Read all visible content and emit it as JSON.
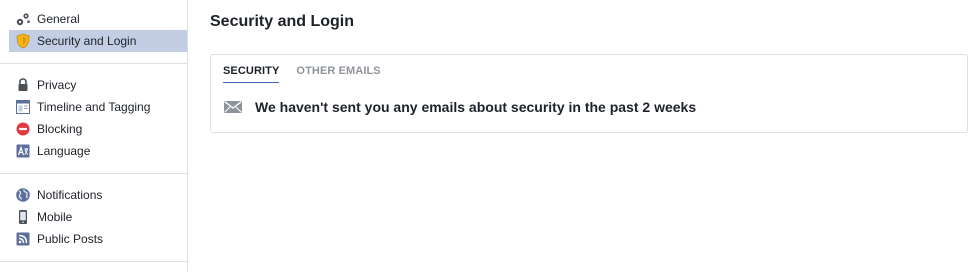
{
  "sidebar": {
    "groups": [
      {
        "items": [
          {
            "label": "General",
            "icon": "gears-icon"
          },
          {
            "label": "Security and Login",
            "icon": "shield-icon",
            "selected": true
          }
        ]
      },
      {
        "items": [
          {
            "label": "Privacy",
            "icon": "lock-icon"
          },
          {
            "label": "Timeline and Tagging",
            "icon": "timeline-icon"
          },
          {
            "label": "Blocking",
            "icon": "blocking-icon"
          },
          {
            "label": "Language",
            "icon": "language-icon"
          }
        ]
      },
      {
        "items": [
          {
            "label": "Notifications",
            "icon": "globe-icon"
          },
          {
            "label": "Mobile",
            "icon": "mobile-icon"
          },
          {
            "label": "Public Posts",
            "icon": "rss-icon"
          }
        ]
      }
    ]
  },
  "main": {
    "title": "Security and Login",
    "tabs": [
      {
        "label": "SECURITY",
        "active": true
      },
      {
        "label": "OTHER EMAILS",
        "active": false
      }
    ],
    "message": {
      "icon": "envelope-icon",
      "text": "We haven't sent you any emails about security in the past 2 weeks"
    }
  },
  "colors": {
    "selected_bg": "#c3cde3",
    "tab_underline": "#4267b2",
    "border": "#dddfe2",
    "muted_text": "#90949c"
  }
}
